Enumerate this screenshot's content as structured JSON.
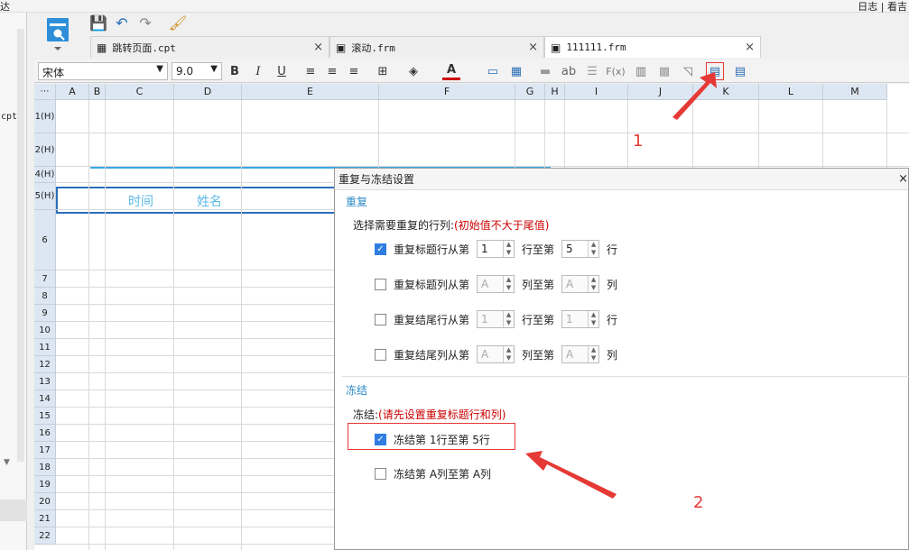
{
  "window": {
    "title_left": "达",
    "title_right": "日志 | 看吉"
  },
  "left_panel": {
    "file_label": "cpt"
  },
  "tabs": [
    {
      "label": "跳转页面.cpt",
      "icon": "table-icon"
    },
    {
      "label": "滚动.frm",
      "icon": "form-icon"
    },
    {
      "label": "111111.frm",
      "icon": "form-icon"
    }
  ],
  "toolbar": {
    "font_name": "宋体",
    "font_size": "9.0",
    "bold": "B",
    "italic": "I",
    "underline": "U",
    "text_label": "ab",
    "formula_label": "F(x)"
  },
  "grid": {
    "columns": [
      "A",
      "B",
      "C",
      "D",
      "E",
      "F",
      "G",
      "H",
      "I",
      "J",
      "K",
      "L",
      "M"
    ],
    "rows": [
      "1(H)",
      "2(H)",
      "4(H)",
      "5(H)",
      "6",
      "7",
      "8",
      "9",
      "10",
      "11",
      "12",
      "13",
      "14",
      "15",
      "16",
      "17",
      "18",
      "19",
      "20",
      "21",
      "22"
    ],
    "cells": {
      "c5": "时间",
      "d5": "姓名"
    }
  },
  "dialog": {
    "title": "重复与冻结设置",
    "close": "×",
    "repeat_section": "重复",
    "repeat_note_label": "选择需要重复的行列:",
    "repeat_note_hint": "(初始值不大于尾值)",
    "rows": [
      {
        "label": "重复标题行从第",
        "from": "1",
        "mid": "行至第",
        "to": "5",
        "unit": "行",
        "checked": true
      },
      {
        "label": "重复标题列从第",
        "from": "A",
        "mid": "列至第",
        "to": "A",
        "unit": "列",
        "checked": false
      },
      {
        "label": "重复结尾行从第",
        "from": "1",
        "mid": "行至第",
        "to": "1",
        "unit": "行",
        "checked": false
      },
      {
        "label": "重复结尾列从第",
        "from": "A",
        "mid": "列至第",
        "to": "A",
        "unit": "列",
        "checked": false
      }
    ],
    "freeze_section": "冻结",
    "freeze_note_label": "冻结:",
    "freeze_note_hint": "(请先设置重复标题行和列)",
    "freeze_rows": "冻结第 1行至第 5行",
    "freeze_cols": "冻结第 A列至第 A列"
  },
  "annotations": {
    "one": "1",
    "two": "2",
    "color": "#e53935"
  }
}
